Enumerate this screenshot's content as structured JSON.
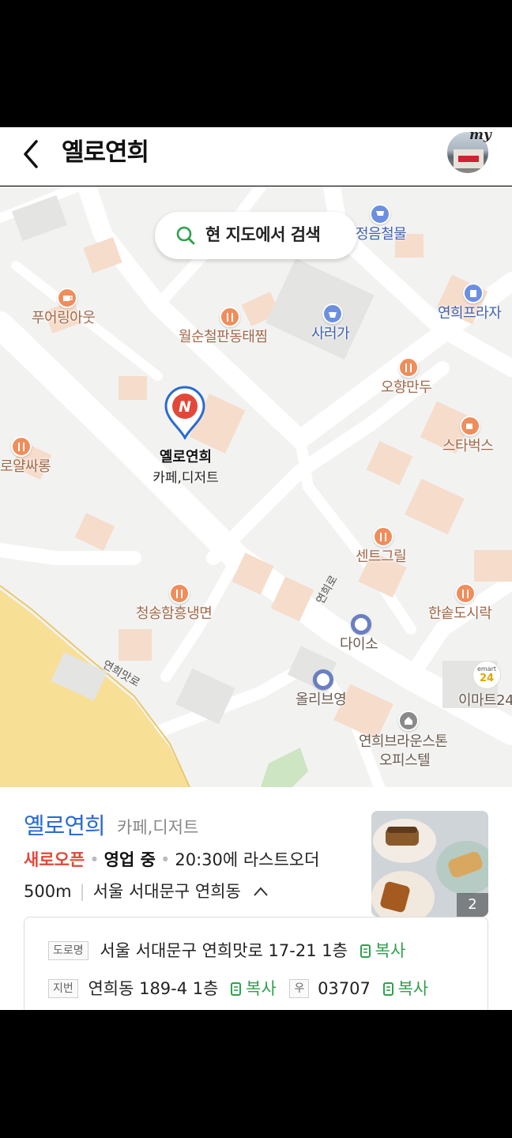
{
  "header": {
    "title": "옐로연희",
    "my_label": "my"
  },
  "map": {
    "search_label": "현 지도에서 검색",
    "marker": {
      "name": "옐로연희",
      "category": "카페,디저트",
      "badge": "N"
    },
    "pois": [
      {
        "name": "정음철물"
      },
      {
        "name": "푸어링아웃"
      },
      {
        "name": "월순철판동태찜"
      },
      {
        "name": "사러가"
      },
      {
        "name": "연희프라자"
      },
      {
        "name": "오향만두"
      },
      {
        "name": "스타벅스"
      },
      {
        "name": "로얄싸롱"
      },
      {
        "name": "센트그릴"
      },
      {
        "name": "청송함흥냉면"
      },
      {
        "name": "한솥도시락"
      },
      {
        "name": "다이소"
      },
      {
        "name": "올리브영"
      },
      {
        "name": "이마트24"
      },
      {
        "name": "연희브라운스톤"
      },
      {
        "name": "오피스텔"
      }
    ],
    "streets": [
      "연희맛로",
      "연희로"
    ],
    "emart_badge_top": "emart",
    "emart_badge_num": "24"
  },
  "info": {
    "name": "옐로연희",
    "category": "카페,디저트",
    "status_new": "새로오픈",
    "status_open": "영업 중",
    "last_order": "20:30에 라스트오더",
    "distance": "500m",
    "address_short": "서울 서대문구 연희동",
    "photo_count": "2",
    "road_tag": "도로명",
    "road_address": "서울 서대문구 연희맛로 17-21 1층",
    "lot_tag": "지번",
    "lot_address": "연희동 189-4 1층",
    "zip_tag": "우",
    "zip": "03707",
    "copy_label": "복사"
  },
  "colors": {
    "accent_blue": "#2a6bd1",
    "new_red": "#e2483a",
    "copy_green": "#2fa14a",
    "poi_orange": "#ef8d5b"
  }
}
